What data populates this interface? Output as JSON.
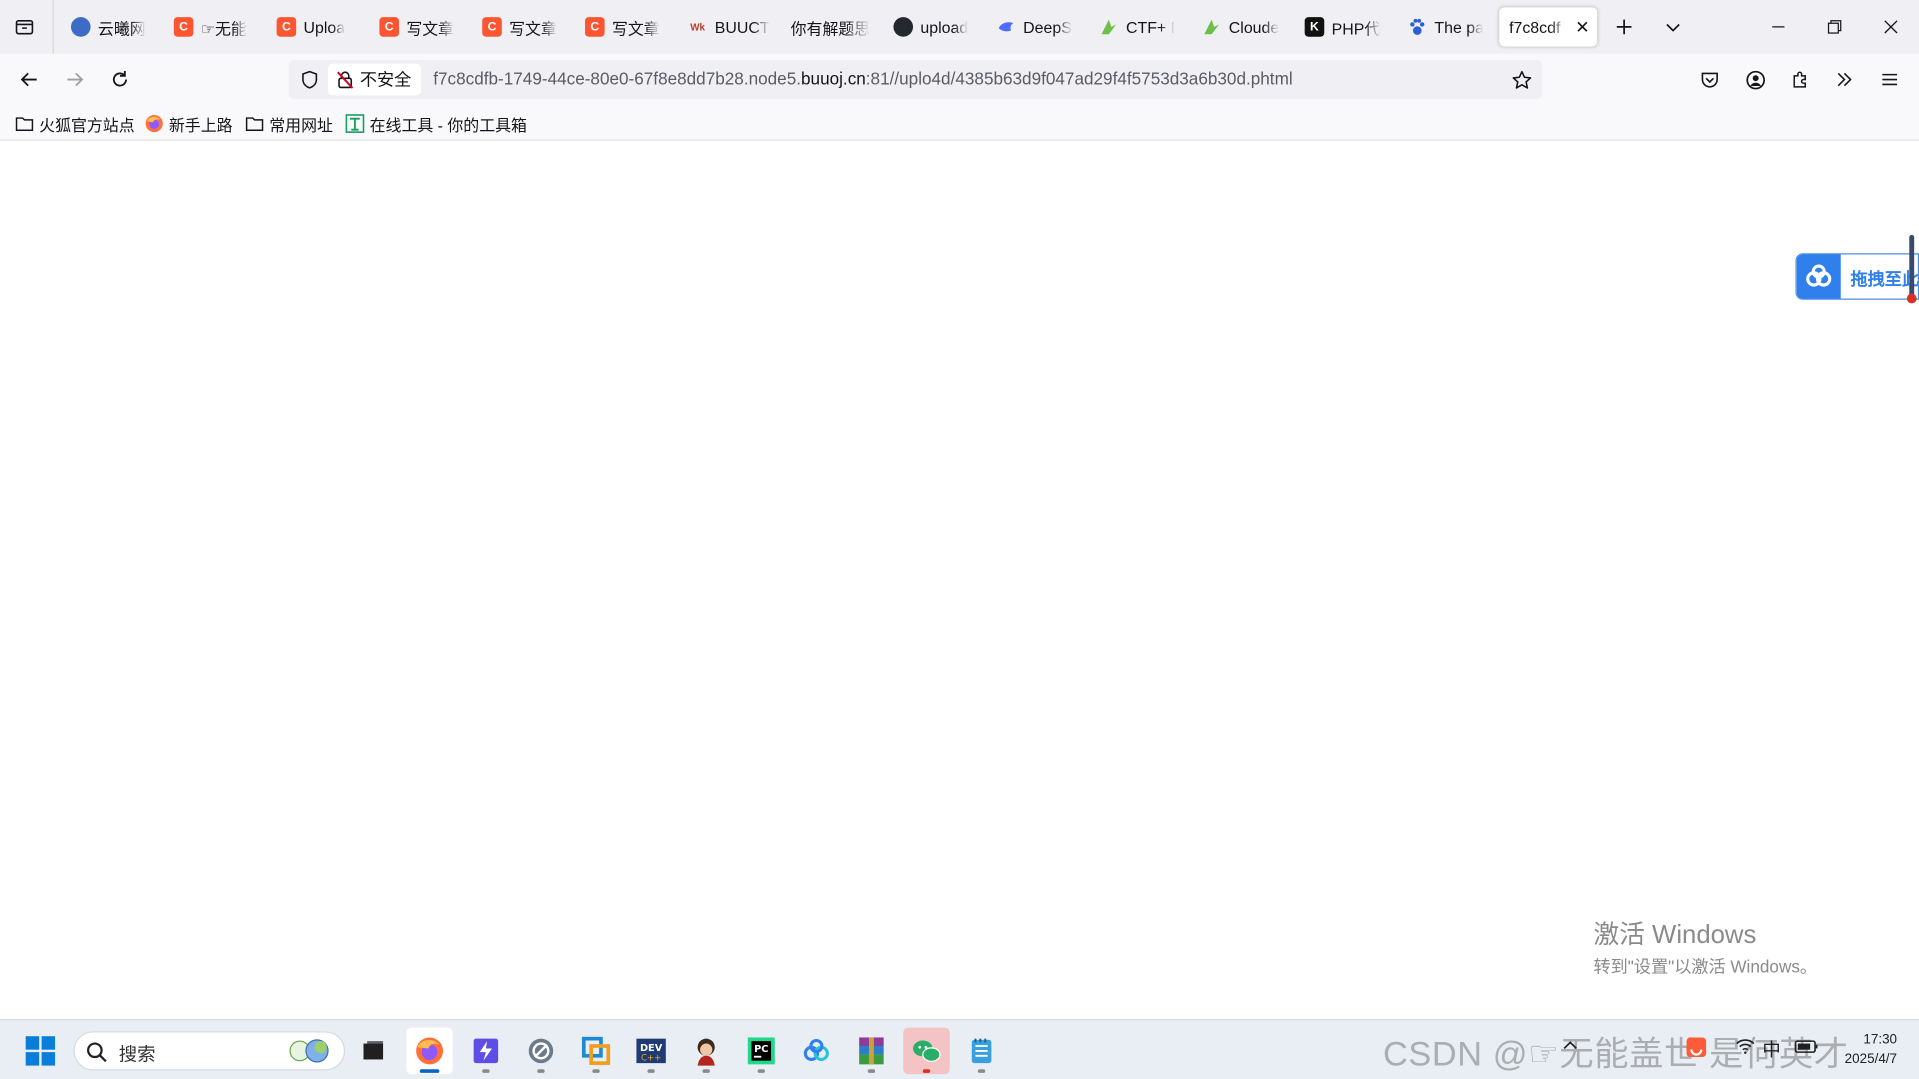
{
  "tabs": [
    {
      "title": "云曦网",
      "favicon": "C",
      "color": "#3d6cc4"
    },
    {
      "title": "☞无能",
      "favicon": "C",
      "color": "#fc5531"
    },
    {
      "title": "Uploa",
      "favicon": "C",
      "color": "#fc5531"
    },
    {
      "title": "写文章",
      "favicon": "C",
      "color": "#fc5531"
    },
    {
      "title": "写文章",
      "favicon": "C",
      "color": "#fc5531"
    },
    {
      "title": "写文章",
      "favicon": "C",
      "color": "#fc5531"
    },
    {
      "title": "BUUCT",
      "favicon": "buu",
      "color": "#c0392b"
    },
    {
      "title": "你有解题思",
      "favicon": "",
      "color": "#ffffff"
    },
    {
      "title": "upload",
      "favicon": "gh",
      "color": "#24292f"
    },
    {
      "title": "DeepS",
      "favicon": "ds",
      "color": "#4d6bfe"
    },
    {
      "title": "CTF+ I",
      "favicon": "ctf",
      "color": "#6cc04a"
    },
    {
      "title": "Cloude",
      "favicon": "ctf",
      "color": "#6cc04a"
    },
    {
      "title": "PHP代",
      "favicon": "K",
      "color": "#111111"
    },
    {
      "title": "The pa",
      "favicon": "paw",
      "color": "#2b5fd9"
    },
    {
      "title": "f7c8cdf",
      "favicon": "",
      "color": "#ffffff",
      "active": true
    }
  ],
  "nav": {
    "insecure_label": "不安全",
    "url_prefix": "f7c8cdfb-1749-44ce-80e0-67f8e8dd7b28.node5.",
    "url_host": "buuoj.cn",
    "url_suffix": ":81//uplo4d/4385b63d9f047ad29f4f5753d3a6b30d.phtml"
  },
  "bookmarks": [
    {
      "label": "火狐官方站点",
      "icon": "folder-icon"
    },
    {
      "label": "新手上路",
      "icon": "firefox-icon"
    },
    {
      "label": "常用网址",
      "icon": "folder-icon"
    },
    {
      "label": "在线工具 - 你的工具箱",
      "icon": "tool-icon"
    }
  ],
  "overlay": {
    "baidu_label": "拖拽至此"
  },
  "activation": {
    "title": "激活 Windows",
    "subtitle": "转到\"设置\"以激活 Windows。"
  },
  "taskbar": {
    "search_placeholder": "搜索",
    "watermark": "CSDN @☞无能盖世 是何英才",
    "clock_time": "17:30",
    "clock_date": "2025/4/7",
    "tray_lang": "中"
  }
}
